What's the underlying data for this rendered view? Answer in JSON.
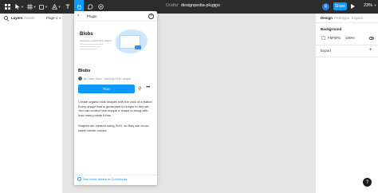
{
  "toolbar": {
    "breadcrumb_drafts": "Drafts",
    "breadcrumb_sep": "/",
    "file_name": "designpedia-plugins",
    "avatar_initial": "R",
    "share_label": "Share",
    "zoom": "23%"
  },
  "left_panel": {
    "tab_layers": "Layers",
    "tab_assets": "Assets",
    "page_select": "Page 1"
  },
  "right_panel": {
    "tab_design": "Design",
    "tab_prototype": "Prototype",
    "tab_inspect": "Inspect",
    "background_label": "Background",
    "background_hex": "F5F5F5",
    "background_opacity": "100%",
    "export_label": "Export"
  },
  "plugin": {
    "header_title": "Plugin",
    "cover_title": "Blobs",
    "cover_subtitle": "Generate organic blob shapes",
    "name": "Blobs",
    "author_line": "By Ozan Tokol · Used by 331K people",
    "run_label": "Run",
    "description_1": "Create organic blob shapes with the click of a button. Every shape that is generated is unique to this set. You can control how unique a shape is along with how many points it has.",
    "description_2": "Shapes are created using SVG, so they are oh-so-sweet bézier curves.",
    "community_link": "See more details in Community"
  },
  "help_label": "?",
  "colors": {
    "toolbar_bg": "#2c2c2c",
    "accent": "#0d99ff",
    "canvas_bg": "#e5e5e5"
  },
  "icons": [
    "figma-menu-icon",
    "move-icon",
    "frame-icon",
    "shape-icon",
    "pen-icon",
    "text-icon",
    "hand-icon",
    "comment-icon",
    "plugin-icon",
    "search-icon",
    "eye-icon",
    "plus-icon",
    "back-arrow-icon",
    "close-icon",
    "link-icon",
    "more-icon",
    "community-icon",
    "play-icon"
  ]
}
